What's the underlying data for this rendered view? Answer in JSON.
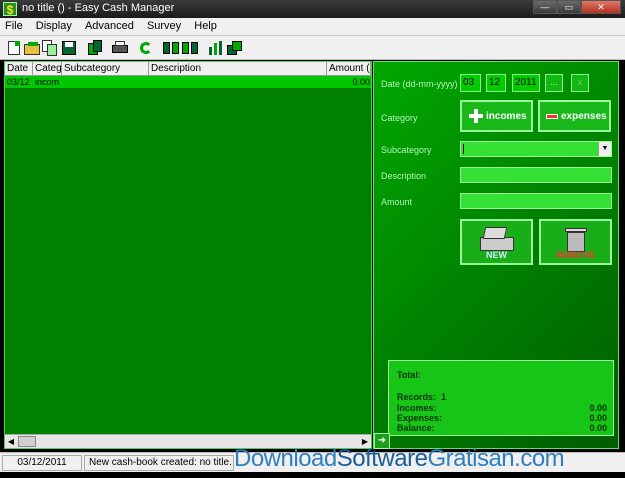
{
  "window": {
    "title": "no title () - Easy Cash Manager",
    "icon": "dollar-icon"
  },
  "menu": [
    "File",
    "Display",
    "Advanced",
    "Survey",
    "Help"
  ],
  "toolbar": {
    "icons": [
      "new-file-icon",
      "open-folder-icon",
      "copy-icon",
      "save-icon",
      "clipboard-icon",
      "print-icon",
      "refresh-icon",
      "columns-icon",
      "columns-icon",
      "bar-chart-icon",
      "windows-icon"
    ]
  },
  "grid": {
    "columns": [
      "Date",
      "Categ",
      "Subcategory",
      "Description",
      "Amount ($"
    ],
    "rows": [
      {
        "date": "03/12",
        "category": "incom",
        "subcategory": "",
        "description": "",
        "amount": "0.00"
      }
    ]
  },
  "form": {
    "date_label": "Date (dd-mm-yyyy)",
    "day": "03",
    "month": "12",
    "year": "2011",
    "browse_label": "...",
    "clear_label": "x",
    "category_label": "Category",
    "incomes_label": "incomes",
    "expenses_label": "expenses",
    "subcategory_label": "Subcategory",
    "description_label": "Description",
    "amount_label": "Amount",
    "new_label": "NEW",
    "remove_label": "REMOVE"
  },
  "totals": {
    "title": "Total:",
    "records_label": "Records:",
    "records_value": "1",
    "incomes_label": "Incomes:",
    "incomes_value": "0.00",
    "expenses_label": "Expenses:",
    "expenses_value": "0.00",
    "balance_label": "Balance:",
    "balance_value": "0.00"
  },
  "status": {
    "date": "03/12/2011",
    "message": "New cash-book created: no title."
  },
  "watermark": {
    "part1": "Download",
    "part2": "Software",
    "part3": "Gratisan",
    "part4": ".com"
  },
  "colors": {
    "panel_green": "#008000",
    "highlight_green": "#00c800",
    "watermark_blue": "#2f7fc0"
  }
}
